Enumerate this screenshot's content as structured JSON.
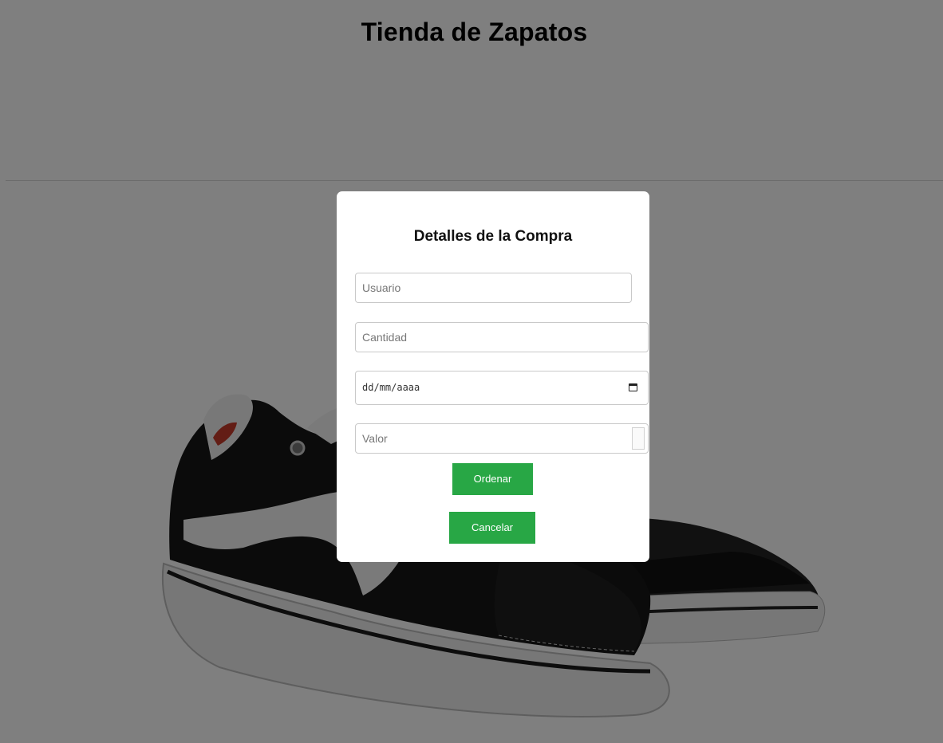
{
  "header": {
    "title": "Tienda de Zapatos"
  },
  "product": {
    "image_icon": "shoe-image"
  },
  "modal": {
    "title": "Detalles de la Compra",
    "usuario_placeholder": "Usuario",
    "cantidad_placeholder": "Cantidad",
    "fecha_placeholder": "dd/mm/aaaa",
    "valor_placeholder": "Valor",
    "ordenar_label": "Ordenar",
    "cancelar_label": "Cancelar"
  },
  "colors": {
    "button_green": "#28a745",
    "overlay": "rgba(0,0,0,0.5)"
  }
}
